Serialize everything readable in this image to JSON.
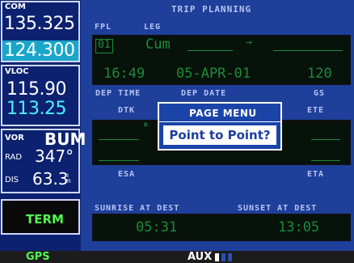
{
  "com": {
    "label": "COM",
    "active": "135.325",
    "standby": "124.300"
  },
  "vloc": {
    "label": "VLOC",
    "active": "115.90",
    "standby": "113.25"
  },
  "vor": {
    "label": "VOR",
    "ident": "BUM",
    "rad_label": "RAD",
    "radial": "347°",
    "dis_label": "DIS",
    "distance": "63.3",
    "distance_unit": "nm"
  },
  "mode": {
    "term": "TERM"
  },
  "page": {
    "title": "TRIP PLANNING",
    "fpl_label": "FPL",
    "leg_label": "LEG",
    "fpl_value": "01",
    "leg_from": "Cum",
    "arrow": "→",
    "dep_time": "16:49",
    "dep_date": "05-APR-01",
    "gs": "120",
    "dep_time_label": "DEP TIME",
    "dep_date_label": "DEP DATE",
    "gs_label": "GS",
    "dtk_label": "DTK",
    "ete_label": "ETE",
    "esa_label": "ESA",
    "eta_label": "ETA",
    "sunrise_label": "SUNRISE AT DEST",
    "sunset_label": "SUNSET AT DEST",
    "sunrise": "05:31",
    "sunset": "13:05"
  },
  "popup": {
    "title": "PAGE MENU",
    "item": "Point to Point?"
  },
  "bottom": {
    "gps": "GPS",
    "aux": "AUX"
  },
  "colors": {
    "background": "#1e3f9a",
    "field_green": "#1e8a3a",
    "highlight_cyan": "#1aa6c9",
    "term_green": "#4dff4d"
  }
}
